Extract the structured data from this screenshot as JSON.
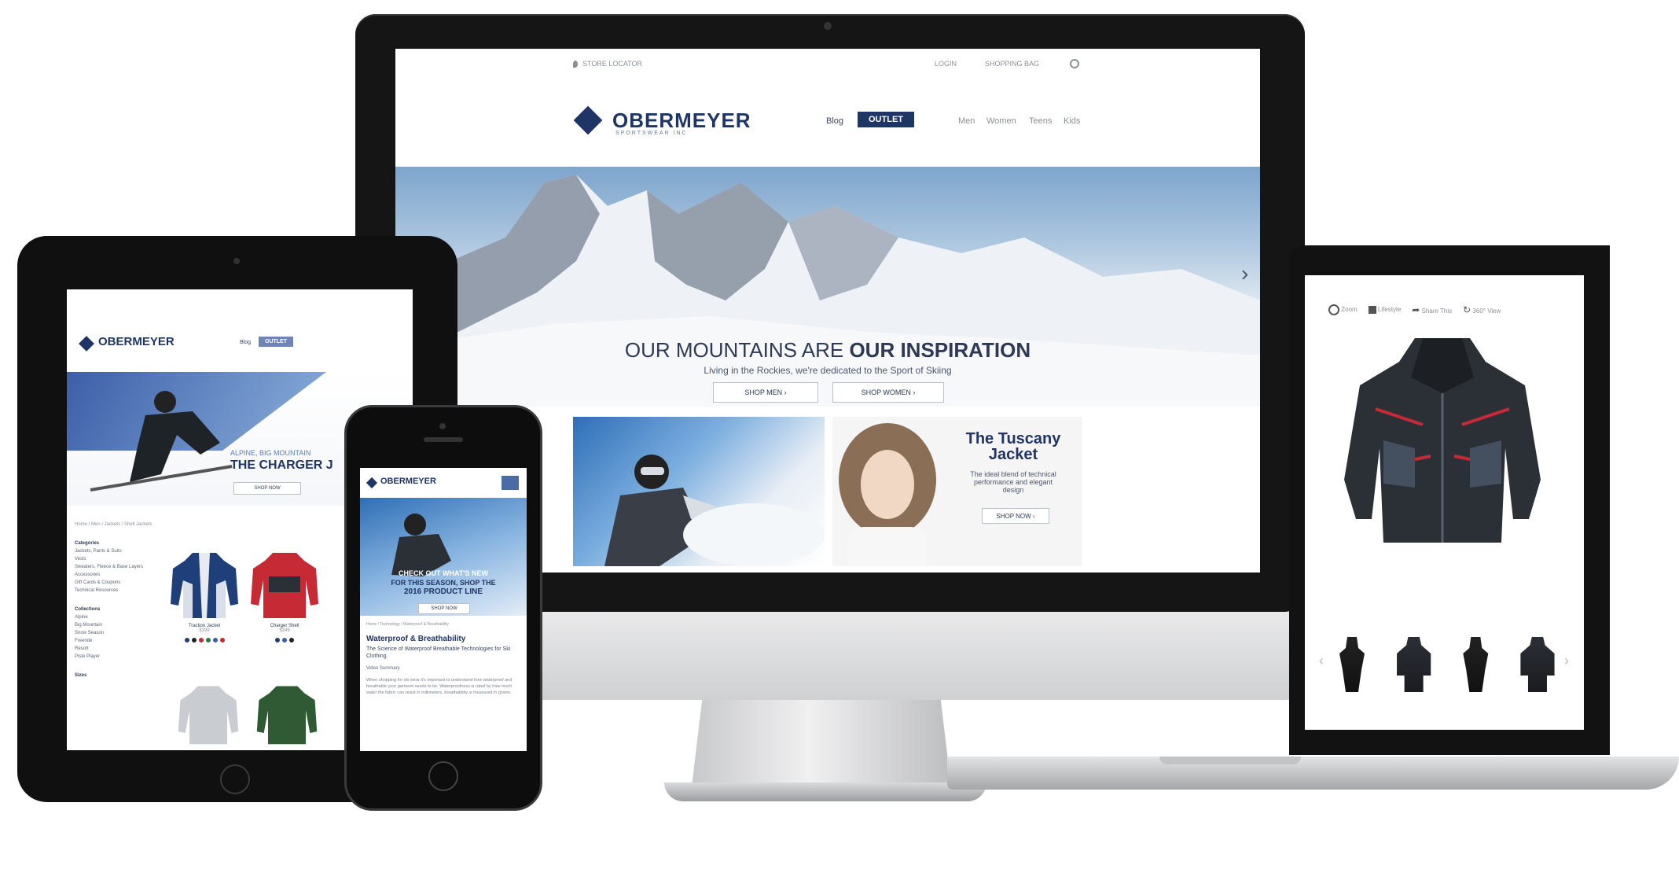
{
  "site": {
    "logo_text": "OBERMEYER",
    "logo_tagline": "SPORTSWEAR INC",
    "topbar": {
      "store_locator": "STORE LOCATOR",
      "login": "LOGIN",
      "shopping_bag": "SHOPPING BAG"
    },
    "nav": {
      "blog": "Blog",
      "outlet": "OUTLET",
      "men": "Men",
      "women": "Women",
      "teens": "Teens",
      "kids": "Kids"
    }
  },
  "desktop": {
    "hero_title_light": "OUR MOUNTAINS ARE",
    "hero_title_bold": "OUR INSPIRATION",
    "hero_subtitle": "Living in the Rockies, we're dedicated to the Sport of Skiing",
    "shop_men": "SHOP MEN",
    "shop_women": "SHOP WOMEN",
    "promo_title": "The Tuscany Jacket",
    "promo_text": "The ideal blend of technical performance and elegant design",
    "promo_button": "SHOP NOW"
  },
  "tablet": {
    "banner_kicker": "ALPINE, BIG MOUNTAIN",
    "banner_title": "THE CHARGER J",
    "shop_now": "SHOP NOW",
    "breadcrumb": "Home / Men / Jackets / Shell Jackets",
    "filters": {
      "categories_heading": "Categories",
      "categories": [
        "Jackets, Pants & Suits",
        "Vests",
        "Sweaters, Fleece & Base Layers",
        "Accessories",
        "Gift Cards & Coupons",
        "Technical Resources"
      ],
      "collections_heading": "Collections",
      "collections": [
        "Alpine",
        "Big Mountain",
        "Snow Season",
        "Freeride",
        "Resort",
        "Piste Player"
      ],
      "sizes_heading": "Sizes"
    },
    "products": [
      {
        "name": "Traction Jacket",
        "price": "$399"
      },
      {
        "name": "Charger Shell",
        "price": "$349"
      }
    ]
  },
  "phone": {
    "banner_text_1": "CHECK OUT WHAT'S NEW",
    "banner_text_2": "FOR THIS SEASON, SHOP THE",
    "banner_text_3": "2016 PRODUCT LINE",
    "shop_now": "SHOP NOW",
    "breadcrumb": "Home / Technology / Waterproof & Breathability",
    "article_title": "Waterproof & Breathability",
    "article_subtitle": "The Science of Waterproof Breathable Technologies for Ski Clothing",
    "article_label": "Video Summary",
    "article_body": "When shopping for ski wear it's important to understand how waterproof and breathable your garment needs to be. Waterproofness is rated by how much water the fabric can resist in millimeters, breathability is measured in grams."
  },
  "laptop": {
    "toolbar": [
      "Zoom",
      "Lifestyle",
      "Share This",
      "360° View"
    ]
  },
  "colors": {
    "brand_navy": "#1f3566",
    "jacket_red": "#c52a35",
    "jacket_dark": "#2b2f36"
  }
}
